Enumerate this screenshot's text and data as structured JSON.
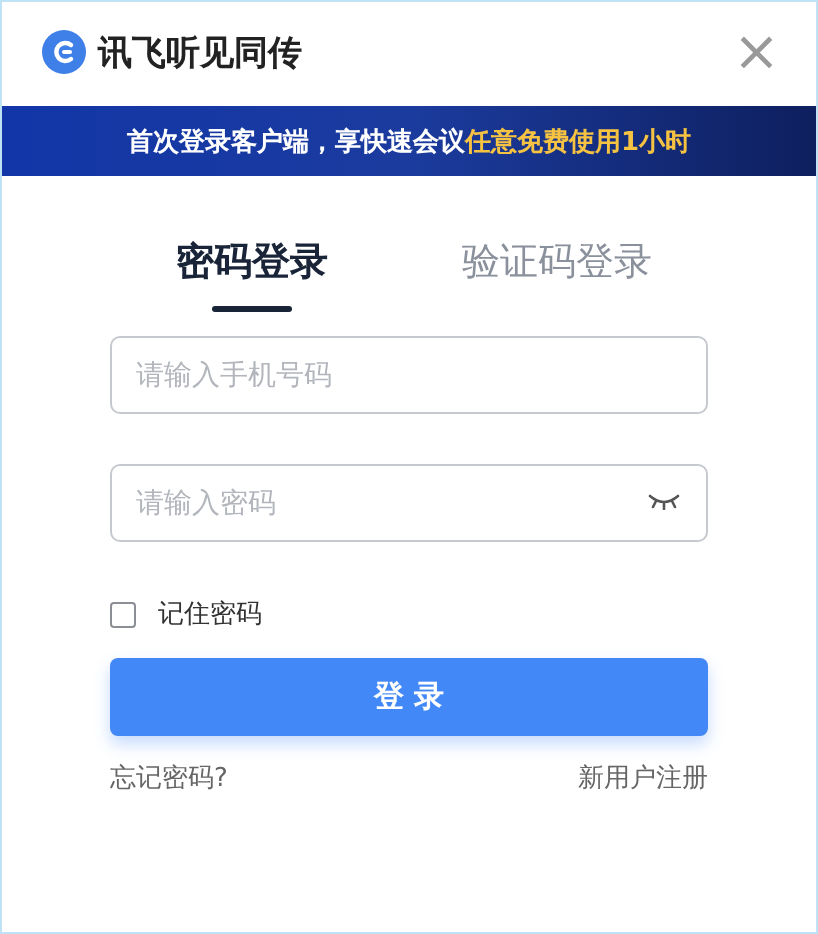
{
  "window": {
    "title": "讯飞听见同传",
    "close": "×"
  },
  "banner": {
    "message": "首次登录客户端，享快速会议",
    "offer": "任意免费使用1小时"
  },
  "tabs": [
    {
      "label": "密码登录",
      "selected": true
    },
    {
      "label": "验证码登录",
      "selected": false
    }
  ],
  "phone_field": {
    "placeholder": "请输入手机号码"
  },
  "password_field": {
    "placeholder": "请输入密码"
  },
  "remember": {
    "label": "记住密码",
    "checked": false
  },
  "login_button": "登 录",
  "links": {
    "forgot": "忘记密码?",
    "register": "新用户注册"
  }
}
